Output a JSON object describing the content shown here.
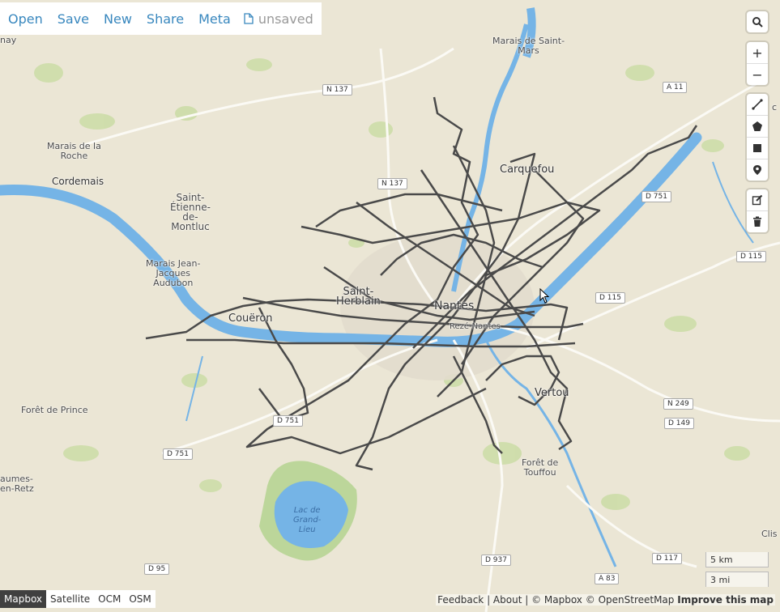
{
  "menu": {
    "open": "Open",
    "save": "Save",
    "new": "New",
    "share": "Share",
    "meta": "Meta",
    "file_status": "unsaved"
  },
  "map_labels": {
    "places": {
      "nay": "nay",
      "marais_saint_mars": "Marais de Saint-\nMars",
      "marais_roche": "Marais de la\nRoche",
      "cordemais": "Cordemais",
      "saint_etienne": "Saint-\nÉtienne-\nde-\nMontluc",
      "marais_jean": "Marais Jean-\nJacques\nAudubon",
      "carquefou": "Carquefou",
      "saint_herblain": "Saint-\nHerblain",
      "nantes": "Nantes",
      "reze": "Rezé-Nantes",
      "coueron": "Couëron",
      "vertou": "Vertou",
      "foret_prince": "Forêt de Prince",
      "foret_touffou": "Forêt de\nTouffou",
      "machecoul": "aumes-\nen-Retz",
      "clisson": "Clis",
      "c_right": "c"
    },
    "water": {
      "lac": "Lac de\nGrand-\nLieu"
    },
    "roads": {
      "n137a": "N 137",
      "n137b": "N 137",
      "a11": "A 11",
      "d751a": "D 751",
      "d115a": "D 115",
      "d115b": "D 115",
      "n249": "N 249",
      "d149": "D 149",
      "d751b": "D 751",
      "d751c": "D 751",
      "d95": "D 95",
      "d937": "D 937",
      "d117": "D 117",
      "a83": "A 83"
    }
  },
  "controls": {
    "search_icon": "search-icon",
    "zoom_in": "+",
    "zoom_out": "−"
  },
  "layers": [
    "Mapbox",
    "Satellite",
    "OCM",
    "OSM"
  ],
  "active_layer": "Mapbox",
  "attribution": {
    "feedback": "Feedback",
    "about": "About",
    "copy_mapbox": "© Mapbox",
    "copy_osm": "© OpenStreetMap",
    "improve": "Improve this map"
  },
  "scale": {
    "metric": "5 km",
    "imperial": "3 mi"
  },
  "colors": {
    "water": "#75b4e6",
    "land": "#e9e4d6",
    "track": "#4a4a4a",
    "accent": "#3887be"
  }
}
